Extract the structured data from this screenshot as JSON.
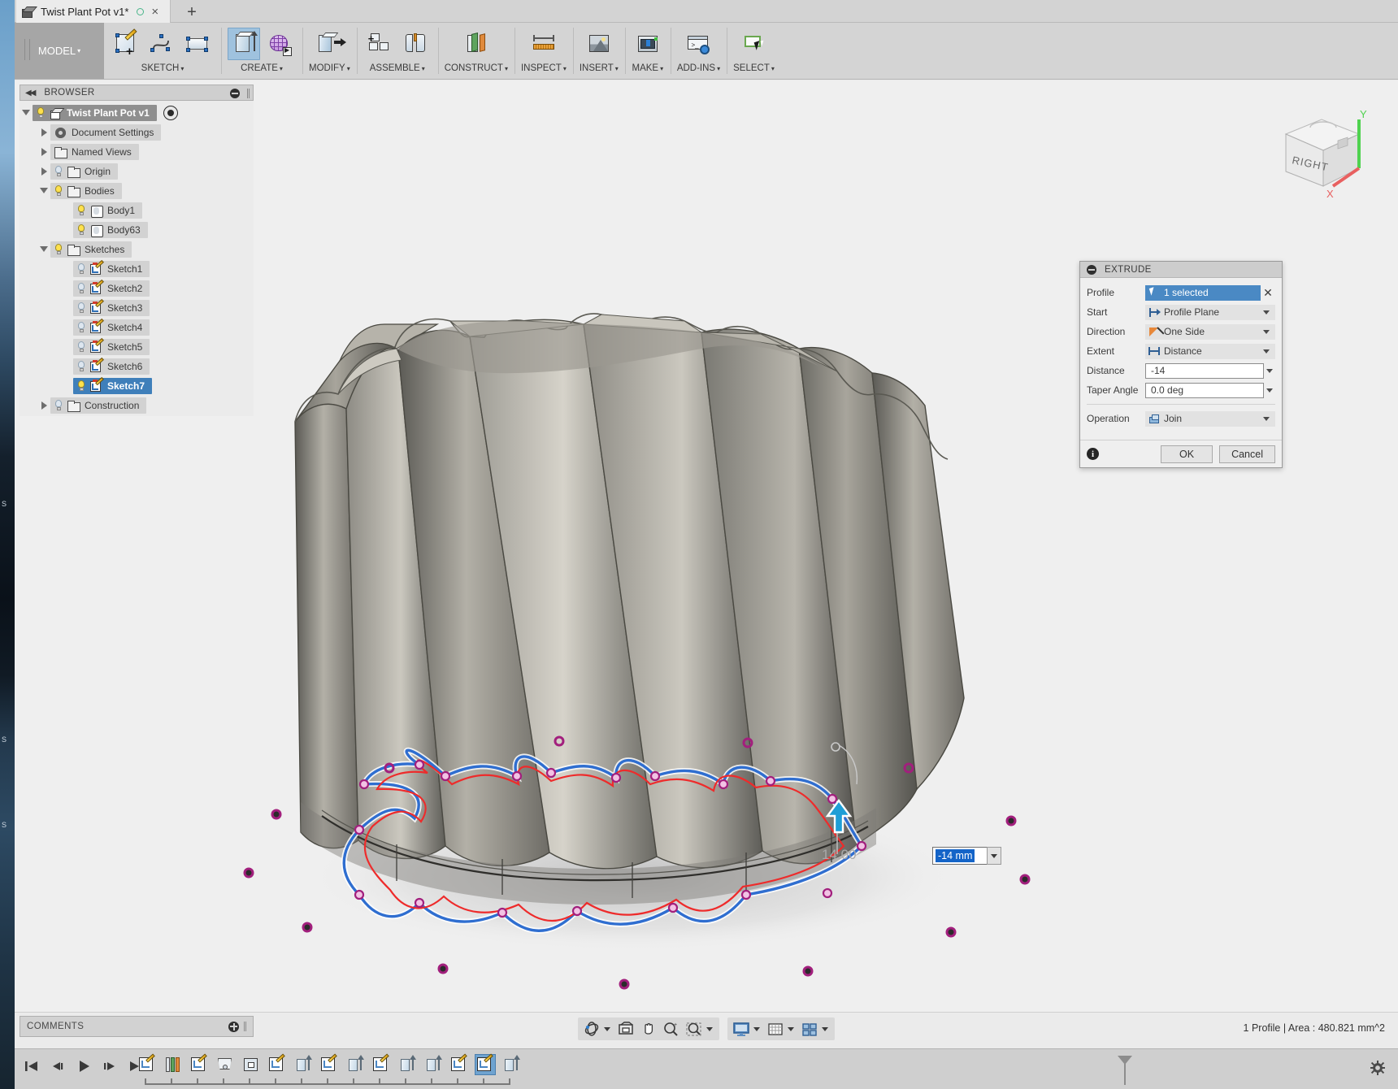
{
  "window": {
    "tab_title": "Twist Plant Pot v1*",
    "new_tab_label": "+",
    "close_label": "×"
  },
  "ribbon": {
    "workspace": "MODEL",
    "workspace_caret": "▾",
    "panels": [
      {
        "name": "sketch",
        "label": "SKETCH",
        "caret": "▾"
      },
      {
        "name": "create",
        "label": "CREATE",
        "caret": "▾"
      },
      {
        "name": "modify",
        "label": "MODIFY",
        "caret": "▾"
      },
      {
        "name": "assemble",
        "label": "ASSEMBLE",
        "caret": "▾"
      },
      {
        "name": "construct",
        "label": "CONSTRUCT",
        "caret": "▾"
      },
      {
        "name": "inspect",
        "label": "INSPECT",
        "caret": "▾"
      },
      {
        "name": "insert",
        "label": "INSERT",
        "caret": "▾"
      },
      {
        "name": "make",
        "label": "MAKE",
        "caret": "▾"
      },
      {
        "name": "addins",
        "label": "ADD-INS",
        "caret": "▾"
      },
      {
        "name": "select",
        "label": "SELECT",
        "caret": "▾"
      }
    ]
  },
  "browser": {
    "title": "BROWSER",
    "collapse_glyph": "◀◀",
    "root": {
      "label": "Twist Plant Pot v1",
      "visible": true
    },
    "items": [
      {
        "label": "Document Settings",
        "icon": "gear-icon",
        "indent": 1,
        "arrow": "closed",
        "bulb": "none"
      },
      {
        "label": "Named Views",
        "icon": "folder-icon",
        "indent": 1,
        "arrow": "closed",
        "bulb": "none"
      },
      {
        "label": "Origin",
        "icon": "folder-icon",
        "indent": 1,
        "arrow": "closed",
        "bulb": "off"
      },
      {
        "label": "Bodies",
        "icon": "folder-icon",
        "indent": 1,
        "arrow": "open",
        "bulb": "on"
      },
      {
        "label": "Body1",
        "icon": "body-icon",
        "indent": 2,
        "arrow": "none",
        "bulb": "on"
      },
      {
        "label": "Body63",
        "icon": "body-icon",
        "indent": 2,
        "arrow": "none",
        "bulb": "on"
      },
      {
        "label": "Sketches",
        "icon": "folder-icon",
        "indent": 1,
        "arrow": "open",
        "bulb": "on"
      },
      {
        "label": "Sketch1",
        "icon": "sketch-icon",
        "indent": 2,
        "arrow": "none",
        "bulb": "off"
      },
      {
        "label": "Sketch2",
        "icon": "sketch-icon",
        "indent": 2,
        "arrow": "none",
        "bulb": "off"
      },
      {
        "label": "Sketch3",
        "icon": "sketch-icon",
        "indent": 2,
        "arrow": "none",
        "bulb": "off"
      },
      {
        "label": "Sketch4",
        "icon": "sketch-icon",
        "indent": 2,
        "arrow": "none",
        "bulb": "off"
      },
      {
        "label": "Sketch5",
        "icon": "sketch-icon",
        "indent": 2,
        "arrow": "none",
        "bulb": "off"
      },
      {
        "label": "Sketch6",
        "icon": "sketch-icon",
        "indent": 2,
        "arrow": "none",
        "bulb": "off"
      },
      {
        "label": "Sketch7",
        "icon": "sketch-icon",
        "indent": 2,
        "arrow": "none",
        "bulb": "on",
        "selected": true
      },
      {
        "label": "Construction",
        "icon": "folder-icon",
        "indent": 1,
        "arrow": "closed",
        "bulb": "off"
      }
    ]
  },
  "extrude_dialog": {
    "title": "EXTRUDE",
    "fields": {
      "profile_label": "Profile",
      "profile_value": "1 selected",
      "profile_clear": "✕",
      "start_label": "Start",
      "start_value": "Profile Plane",
      "direction_label": "Direction",
      "direction_value": "One Side",
      "extent_label": "Extent",
      "extent_value": "Distance",
      "distance_label": "Distance",
      "distance_value": "-14",
      "taper_label": "Taper Angle",
      "taper_value": "0.0 deg",
      "operation_label": "Operation",
      "operation_value": "Join"
    },
    "buttons": {
      "ok": "OK",
      "cancel": "Cancel",
      "info": "i"
    }
  },
  "canvas": {
    "dimension_input_value": "-14 mm",
    "dimension_onscreen_label": "14.00",
    "viewcube_face": "RIGHT",
    "axis_x": "X",
    "axis_y": "Y"
  },
  "status": {
    "comments_label": "COMMENTS",
    "selection_info": "1 Profile | Area : 480.821 mm^2"
  },
  "navbar": {
    "items": [
      {
        "name": "orbit-icon",
        "caret": true
      },
      {
        "name": "look-at-icon",
        "caret": false
      },
      {
        "name": "pan-icon",
        "caret": false
      },
      {
        "name": "zoom-icon",
        "caret": false
      },
      {
        "name": "zoom-window-icon",
        "caret": true
      },
      {
        "name": "display-settings-icon",
        "caret": true
      },
      {
        "name": "grid-snap-icon",
        "caret": true
      },
      {
        "name": "viewports-icon",
        "caret": true
      }
    ]
  },
  "timeline": {
    "playback": [
      "jump-start-icon",
      "step-back-icon",
      "play-icon",
      "step-forward-icon",
      "jump-end-icon"
    ],
    "features": [
      {
        "type": "sketch",
        "selected": false
      },
      {
        "type": "loft",
        "selected": false
      },
      {
        "type": "sketch",
        "selected": false
      },
      {
        "type": "plane",
        "selected": false
      },
      {
        "type": "shell",
        "selected": false
      },
      {
        "type": "sketch",
        "selected": false
      },
      {
        "type": "extrude",
        "selected": false
      },
      {
        "type": "sketch",
        "selected": false
      },
      {
        "type": "extrude",
        "selected": false
      },
      {
        "type": "sketch",
        "selected": false
      },
      {
        "type": "extrude",
        "selected": false
      },
      {
        "type": "extrude",
        "selected": false
      },
      {
        "type": "sketch",
        "selected": false
      },
      {
        "type": "sketch",
        "selected": true
      },
      {
        "type": "extrude",
        "selected": false
      }
    ]
  },
  "colors": {
    "accent_blue": "#3f7fba",
    "ribbon_bg": "#d4d4d4",
    "canvas_bg": "#efefef",
    "sketch_profile_blue": "#2f6ed0",
    "sketch_profile_red": "#ee2b2b",
    "sketch_point_magenta": "#a21f7d",
    "arrow_blue": "#1e9ed6"
  }
}
